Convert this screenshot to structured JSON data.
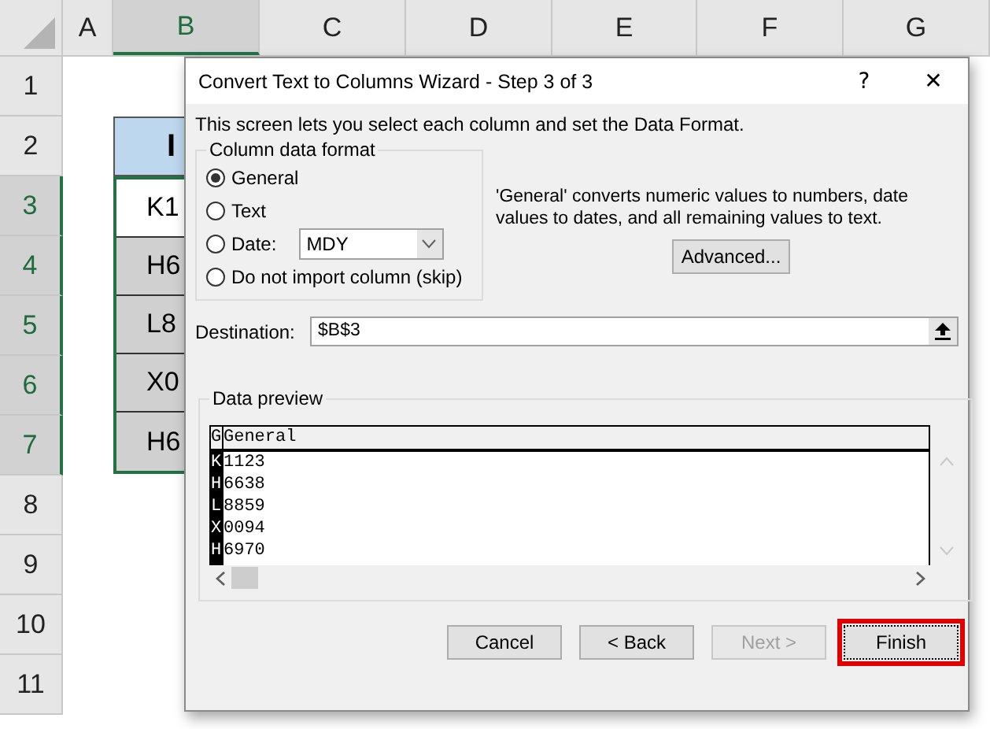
{
  "sheet": {
    "columns": [
      {
        "label": "A",
        "selected": false
      },
      {
        "label": "B",
        "selected": true
      },
      {
        "label": "C",
        "selected": false
      },
      {
        "label": "D",
        "selected": false
      },
      {
        "label": "E",
        "selected": false
      },
      {
        "label": "F",
        "selected": false
      },
      {
        "label": "G",
        "selected": false
      }
    ],
    "rows": [
      {
        "label": "1",
        "selected": false
      },
      {
        "label": "2",
        "selected": false
      },
      {
        "label": "3",
        "selected": true
      },
      {
        "label": "4",
        "selected": true
      },
      {
        "label": "5",
        "selected": true
      },
      {
        "label": "6",
        "selected": true
      },
      {
        "label": "7",
        "selected": true
      },
      {
        "label": "8",
        "selected": false
      },
      {
        "label": "9",
        "selected": false
      },
      {
        "label": "10",
        "selected": false
      },
      {
        "label": "11",
        "selected": false
      }
    ],
    "table_header": "I",
    "cells": [
      "K1",
      "H6",
      "L8",
      "X0",
      "H6"
    ]
  },
  "dialog": {
    "title": "Convert Text to Columns Wizard - Step 3 of 3",
    "help": "?",
    "close": "✕",
    "intro": "This screen lets you select each column and set the Data Format.",
    "format_group": "Column data format",
    "options": [
      {
        "label": "General",
        "selected": true
      },
      {
        "label": "Text",
        "selected": false
      },
      {
        "label": "Date:",
        "selected": false,
        "dropdown": "MDY"
      },
      {
        "label": "Do not import column (skip)",
        "selected": false
      }
    ],
    "description": "'General' converts numeric values to numbers, date values to dates, and all remaining values to text.",
    "advanced": "Advanced...",
    "destination_label": "Destination:",
    "destination": "$B$3",
    "preview_label": "Data preview",
    "preview_columns": [
      {
        "header": "G",
        "selected": true,
        "values": [
          "K",
          "H",
          "L",
          "X",
          "H"
        ]
      },
      {
        "header": "General",
        "selected": false,
        "values": [
          "1123",
          "6638",
          "8859",
          "0094",
          "6970"
        ]
      }
    ],
    "buttons": [
      {
        "label": "Cancel",
        "disabled": false,
        "focused": false
      },
      {
        "label": "< Back",
        "disabled": false,
        "focused": false
      },
      {
        "label": "Next >",
        "disabled": true,
        "focused": false
      },
      {
        "label": "Finish",
        "disabled": false,
        "focused": true
      }
    ]
  }
}
